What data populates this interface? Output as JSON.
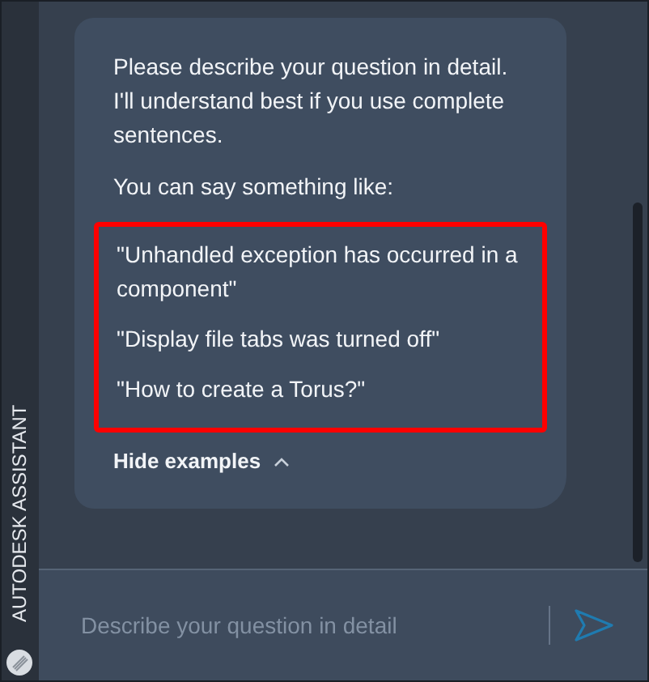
{
  "sidebar": {
    "title": "AUTODESK ASSISTANT"
  },
  "message": {
    "intro": "Please describe your question in detail. I'll understand best if you use complete sentences.",
    "prompt": "You can say something like:",
    "examples": [
      "\"Unhandled exception has occurred in a component\"",
      "\"Display file tabs was turned off\"",
      "\"How to create a Torus?\""
    ],
    "examples_highlighted": true,
    "toggle": {
      "label": "Hide examples",
      "expanded": true
    }
  },
  "input": {
    "placeholder": "Describe your question in detail"
  }
}
